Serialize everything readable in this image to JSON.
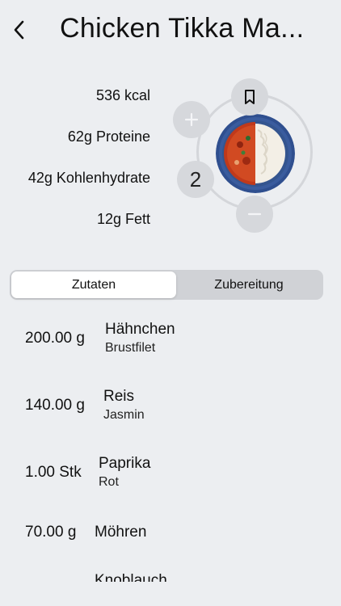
{
  "header": {
    "title": "Chicken Tikka Ma..."
  },
  "macros": {
    "calories": "536 kcal",
    "protein": "62g Proteine",
    "carbs": "42g Kohlenhydrate",
    "fat": "12g Fett"
  },
  "recipe": {
    "servings": "2"
  },
  "tabs": [
    {
      "label": "Zutaten",
      "selected": true
    },
    {
      "label": "Zubereitung",
      "selected": false
    }
  ],
  "ingredients": [
    {
      "amount": "200.00 g",
      "name": "Hähnchen",
      "variant": "Brustfilet"
    },
    {
      "amount": "140.00 g",
      "name": "Reis",
      "variant": "Jasmin"
    },
    {
      "amount": "1.00 Stk",
      "name": "Paprika",
      "variant": "Rot"
    },
    {
      "amount": "70.00 g",
      "name": "Möhren",
      "variant": ""
    },
    {
      "amount": "",
      "name": "Knoblauch",
      "variant": ""
    }
  ],
  "colors": {
    "background": "#eceef1",
    "button_bg": "#d6d8dc",
    "segment_bg": "#d0d2d6",
    "plate_blue": "#2f4f8f"
  }
}
